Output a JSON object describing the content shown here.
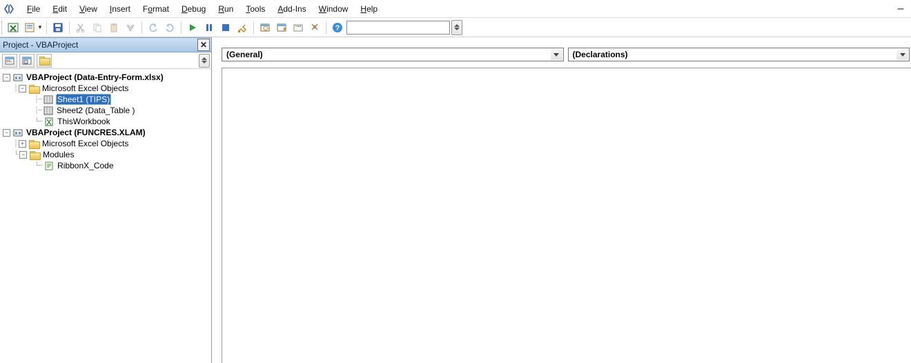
{
  "menu": {
    "file": "File",
    "edit": "Edit",
    "view": "View",
    "insert": "Insert",
    "format": "Format",
    "debug": "Debug",
    "run": "Run",
    "tools": "Tools",
    "addins": "Add-Ins",
    "window": "Window",
    "help": "Help"
  },
  "project_panel": {
    "title": "Project - VBAProject"
  },
  "tree": {
    "proj1": "VBAProject (Data-Entry-Form.xlsx)",
    "group1": "Microsoft Excel Objects",
    "sheet1": "Sheet1 (TIPS)",
    "sheet2": "Sheet2 (Data_Table )",
    "thiswb": "ThisWorkbook",
    "proj2": "VBAProject (FUNCRES.XLAM)",
    "group2": "Microsoft Excel Objects",
    "modules": "Modules",
    "ribbon": "RibbonX_Code"
  },
  "code": {
    "object": "(General)",
    "procedure": "(Declarations)"
  }
}
